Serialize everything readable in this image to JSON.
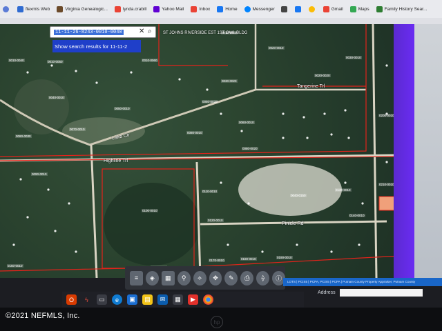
{
  "bookmarks": [
    {
      "label": "flexmls Web",
      "color": "#2f6bd1"
    },
    {
      "label": "Virginia Genealogic...",
      "color": "#6b4a2a"
    },
    {
      "label": "lynda.crabill",
      "color": "#ea4335"
    },
    {
      "label": "Yahoo Mail",
      "color": "#6001d2"
    },
    {
      "label": "Inbox",
      "color": "#ea4335"
    },
    {
      "label": "Home",
      "color": "#1877f2"
    },
    {
      "label": "Messenger",
      "color": "#0084ff"
    },
    {
      "label": "Gmail",
      "color": "#ea4335"
    },
    {
      "label": "Maps",
      "color": "#34a853"
    },
    {
      "label": "Family History Sear...",
      "color": "#2e7d32"
    }
  ],
  "search": {
    "value": "11-11-26-8243-0010-0040",
    "suggestion": "Show search results for 11-11-2"
  },
  "map": {
    "corner_label": "ST JOHNS RIVERSIDE EST 1ST OWL BLDG",
    "streets": {
      "tangerine": "Tangerine Trl",
      "lake": "Lake Cir",
      "highline": "Highline Trl",
      "pinicle": "Pinicle Rd"
    },
    "parcels": [
      "0010-0040",
      "0010-0050",
      "0010-0060",
      "0010-0070",
      "0020-0010",
      "0020-0020",
      "0030-0010",
      "0030-0020",
      "0040-0010",
      "0040-0150",
      "0050-0010",
      "0050-0020",
      "0060-0010",
      "0060-0030",
      "0070-0010",
      "0080-0010",
      "0080-0020",
      "0090-0010",
      "0100-0010",
      "0110-0010",
      "0120-0010",
      "0130-0010",
      "0140-0010",
      "0150-0010",
      "0160-0010",
      "0170-0010",
      "0180-0010",
      "0190-0010",
      "0200-0010",
      "0210-0010"
    ]
  },
  "status_text": "LOTS | PCIS5 | PCPA, PCIS5 | PCPA | Putnam County Property Appraiser, Putnam County",
  "address_label": "Address",
  "watermark": "©2021 NEFMLS, Inc.",
  "hp_logo": "hp",
  "colors": {
    "parcel_line": "#e3231b",
    "map_bg": "#2c4530",
    "right_strip": "#6a2cf2",
    "suggestion_bg": "#1f3fc9"
  }
}
